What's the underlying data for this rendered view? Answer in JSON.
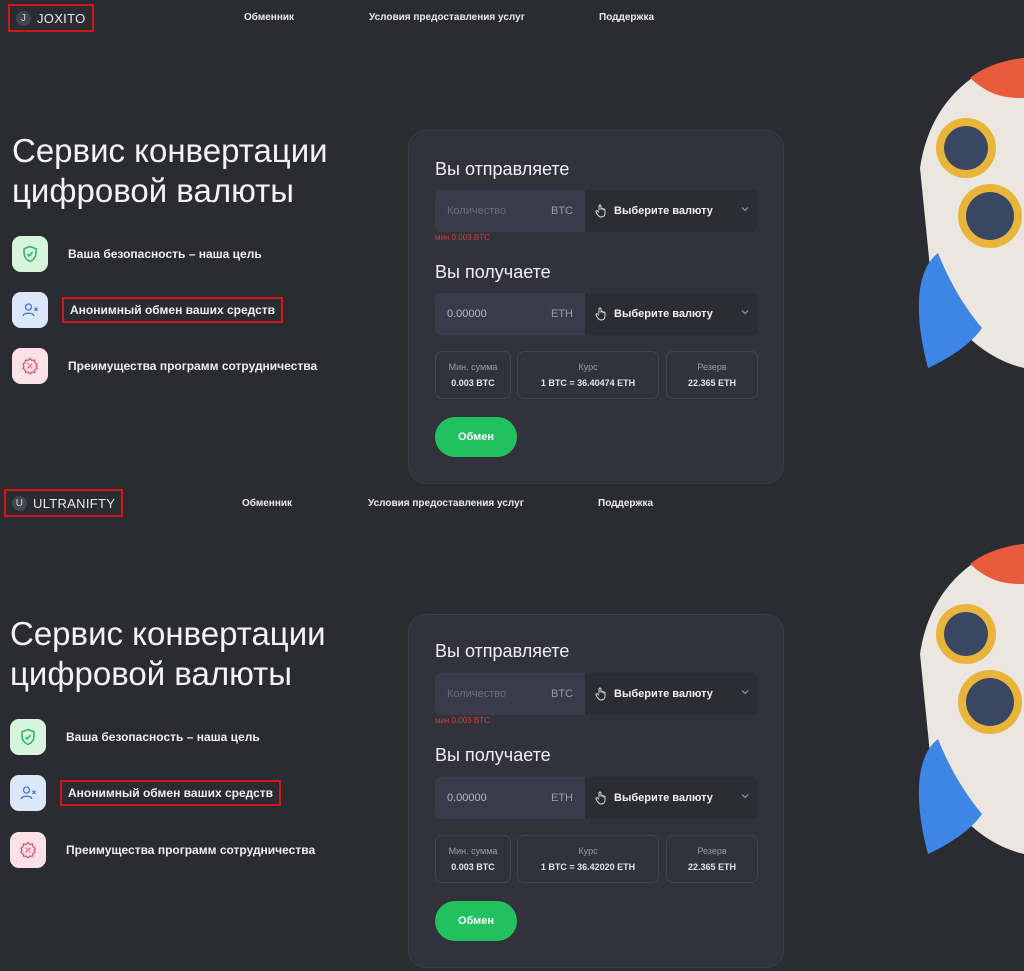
{
  "screens": [
    {
      "logo": {
        "letter": "J",
        "name": "JOXITO"
      },
      "nav": [
        "Обменник",
        "Условия предоставления услуг",
        "Поддержка"
      ],
      "hero_title": [
        "Сервис конвертации",
        "цифровой валюты"
      ],
      "features": [
        {
          "label": "Ваша безопасность – наша цель",
          "icon": "shield-check-icon"
        },
        {
          "label": "Анонимный обмен ваших средств",
          "icon": "user-x-icon"
        },
        {
          "label": "Преимущества программ сотрудничества",
          "icon": "discount-badge-icon"
        }
      ],
      "card": {
        "send_heading": "Вы отправляете",
        "send_placeholder": "Количество",
        "send_currency": "BTC",
        "send_select": "Выберите валюту",
        "min_note": "мин 0.003 BTC",
        "receive_heading": "Вы получаете",
        "receive_value": "0.00000",
        "receive_currency": "ETH",
        "receive_select": "Выберите валюту",
        "stats": [
          {
            "title": "Мин. сумма",
            "value": "0.003 BTC"
          },
          {
            "title": "Курс",
            "value": "1 BTC = 36.40474 ETH"
          },
          {
            "title": "Резерв",
            "value": "22.365 ETH"
          }
        ],
        "button": "Обмен"
      }
    },
    {
      "logo": {
        "letter": "U",
        "name": "ULTRANIFTY"
      },
      "nav": [
        "Обменник",
        "Условия предоставления услуг",
        "Поддержка"
      ],
      "hero_title": [
        "Сервис конвертации",
        "цифровой валюты"
      ],
      "features": [
        {
          "label": "Ваша безопасность – наша цель",
          "icon": "shield-check-icon"
        },
        {
          "label": "Анонимный обмен ваших средств",
          "icon": "user-x-icon"
        },
        {
          "label": "Преимущества программ сотрудничества",
          "icon": "discount-badge-icon"
        }
      ],
      "card": {
        "send_heading": "Вы отправляете",
        "send_placeholder": "Количество",
        "send_currency": "BTC",
        "send_select": "Выберите валюту",
        "min_note": "мин 0.003 BTC",
        "receive_heading": "Вы получаете",
        "receive_value": "0.00000",
        "receive_currency": "ETH",
        "receive_select": "Выберите валюту",
        "stats": [
          {
            "title": "Мин. сумма",
            "value": "0.003 BTC"
          },
          {
            "title": "Курс",
            "value": "1 BTC = 36.42020 ETH"
          },
          {
            "title": "Резерв",
            "value": "22.365 ETH"
          }
        ],
        "button": "Обмен"
      }
    }
  ],
  "colors": {
    "background": "#2b2b32",
    "card": "#32323c",
    "accent_green": "#21c160",
    "highlight_red": "#d01818",
    "error_red": "#d53a3a"
  }
}
